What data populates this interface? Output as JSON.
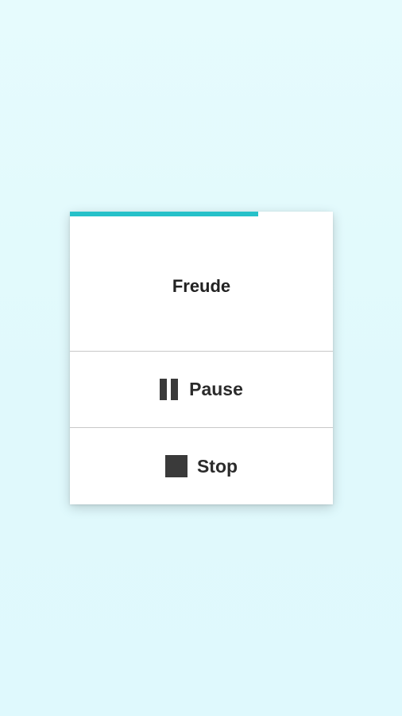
{
  "app": {
    "accent_color": "#26c1c9"
  },
  "player": {
    "title": "Freude",
    "progress": 0.715,
    "actions": {
      "pause": {
        "label": "Pause",
        "icon": "pause-icon"
      },
      "stop": {
        "label": "Stop",
        "icon": "stop-icon"
      }
    }
  }
}
